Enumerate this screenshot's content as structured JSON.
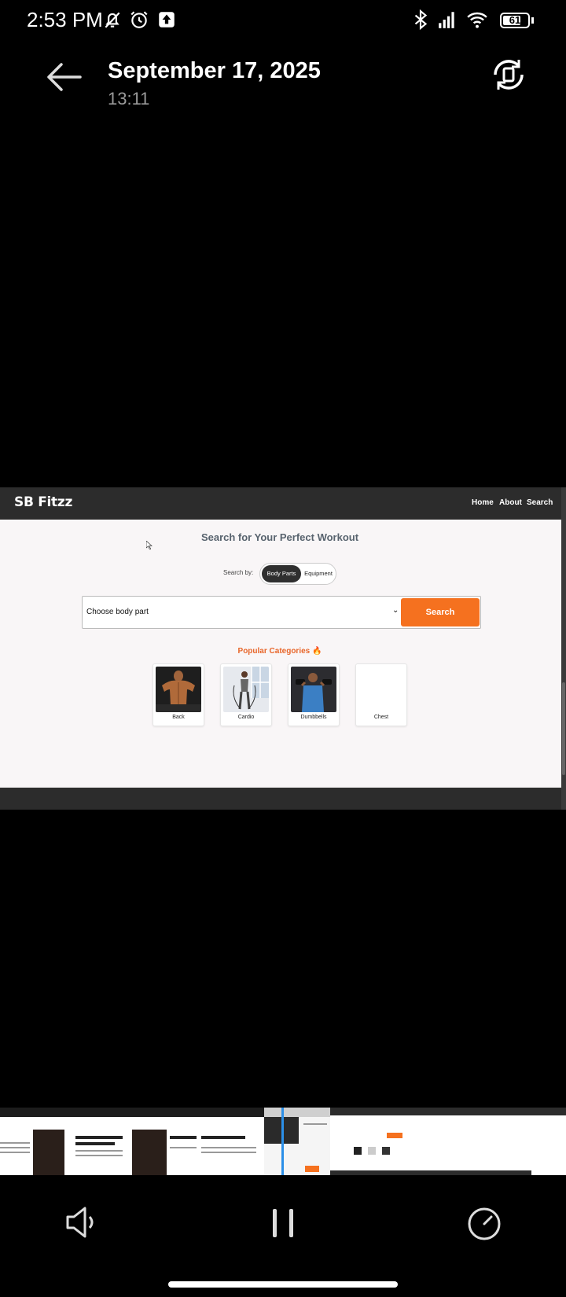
{
  "status_bar": {
    "time": "2:53 PM",
    "battery": "61",
    "icons": [
      "mute-bell-icon",
      "alarm-icon",
      "upload-icon",
      "bluetooth-icon",
      "signal-icon",
      "wifi-icon",
      "battery-icon"
    ]
  },
  "header": {
    "date": "September 17, 2025",
    "time": "13:11",
    "back_icon": "arrow-left-icon",
    "rotate_icon": "rotate-screen-icon"
  },
  "video_frame": {
    "site": {
      "logo": "SB Fitzz",
      "nav": [
        "Home",
        "About",
        "Search"
      ],
      "heading": "Search for Your Perfect Workout",
      "search_by_label": "Search by:",
      "toggle_options": [
        "Body Parts",
        "Equipment"
      ],
      "toggle_selected": "Body Parts",
      "select_value": "Choose body part",
      "search_button": "Search",
      "popular_title": "Popular Categories 🔥",
      "categories": [
        "Back",
        "Cardio",
        "Dumbbells",
        "Chest"
      ]
    }
  },
  "controls": {
    "volume_icon": "speaker-icon",
    "pause_icon": "pause-icon",
    "speed_icon": "speedometer-icon"
  },
  "colors": {
    "accent": "#f5711f",
    "playhead": "#2b8fe8",
    "nav_bg": "#2c2c2c"
  }
}
